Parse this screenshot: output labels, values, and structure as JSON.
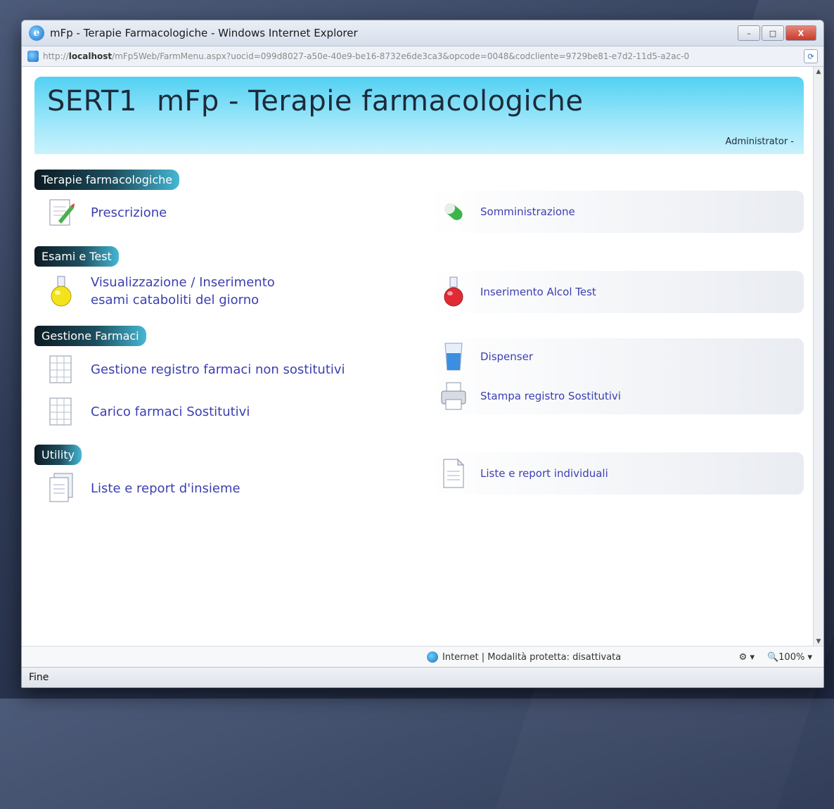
{
  "window": {
    "title": "mFp - Terapie Farmacologiche - Windows Internet Explorer",
    "controls": {
      "minimize": "–",
      "maximize": "□",
      "close": "X"
    }
  },
  "address": {
    "prefix": "http://",
    "host": "localhost",
    "path": "/mFp5Web/FarmMenu.aspx?uocid=099d8027-a50e-40e9-be16-8732e6de3ca3&opcode=0048&codcliente=9729be81-e7d2-11d5-a2ac-0"
  },
  "header": {
    "org": "SERT1",
    "app_title": "mFp - Terapie farmacologiche",
    "user": "Administrator -"
  },
  "sections": {
    "terapie": {
      "label": "Terapie farmacologiche",
      "left": {
        "label": "Prescrizione"
      },
      "right": {
        "label": "Somministrazione"
      }
    },
    "esami": {
      "label": "Esami e Test",
      "left": {
        "line1": "Visualizzazione / Inserimento",
        "line2": "esami cataboliti del giorno"
      },
      "right": {
        "label": "Inserimento Alcol Test"
      }
    },
    "farmaci": {
      "label": "Gestione Farmaci",
      "left1": {
        "label": "Gestione registro farmaci non sostitutivi"
      },
      "left2": {
        "label": "Carico farmaci Sostitutivi"
      },
      "right1": {
        "label": "Dispenser"
      },
      "right2": {
        "label": "Stampa registro Sostitutivi"
      }
    },
    "utility": {
      "label": "Utility",
      "left": {
        "label": "Liste e report d'insieme"
      },
      "right": {
        "label": "Liste e report individuali"
      }
    }
  },
  "status": {
    "zone": "Internet | Modalità protetta: disattivata",
    "zoom": "100%",
    "left_text": "Fine"
  },
  "colors": {
    "banner": "#52d1f2",
    "link": "#3b3fb0",
    "section_tab_dark": "#0c1a22",
    "section_tab_light": "#45b7d4"
  }
}
